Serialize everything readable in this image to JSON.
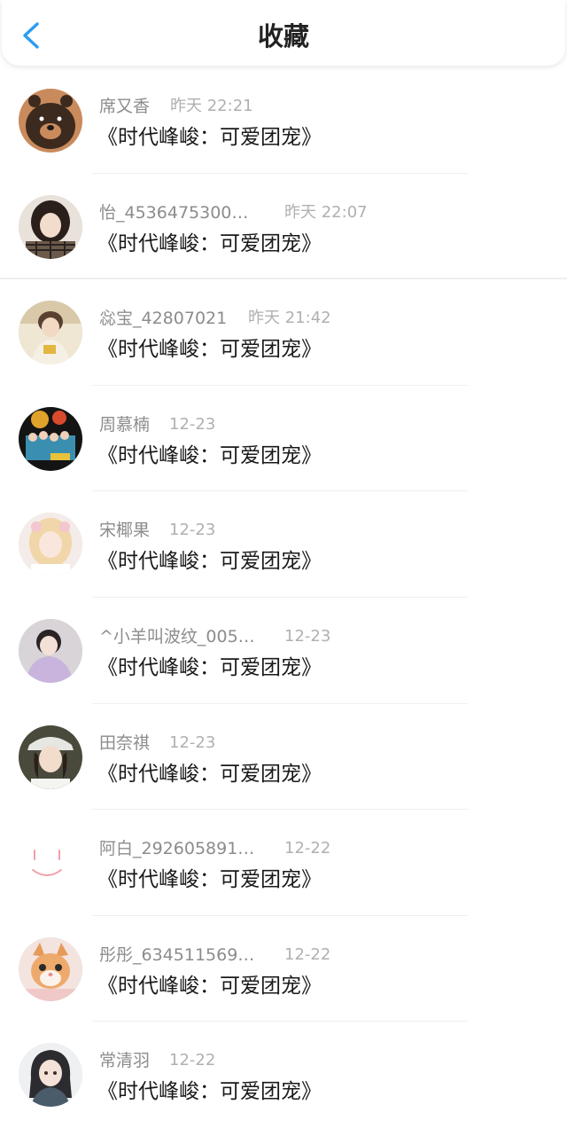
{
  "header": {
    "title": "收藏",
    "back_icon": "chevron-left-icon",
    "accent": "#2b9cf2"
  },
  "items": [
    {
      "name": "席又香",
      "time": "昨天 22:21",
      "post": "《时代峰峻：可爱团宠》",
      "avatar": "bear-avatar"
    },
    {
      "name": "怡_4536475300…",
      "time": "昨天 22:07",
      "post": "《时代峰峻：可爱团宠》",
      "avatar": "girl-photo-avatar"
    },
    {
      "name": "惢宝_42807021",
      "time": "昨天 21:42",
      "post": "《时代峰峻：可爱团宠》",
      "avatar": "boy-photo-avatar"
    },
    {
      "name": "周慕楠",
      "time": "12-23",
      "post": "《时代峰峻：可爱团宠》",
      "avatar": "group-photo-avatar"
    },
    {
      "name": "宋椰果",
      "time": "12-23",
      "post": "《时代峰峻：可爱团宠》",
      "avatar": "blonde-girl-avatar"
    },
    {
      "name": "^小羊叫波纹_005…",
      "time": "12-23",
      "post": "《时代峰峻：可爱团宠》",
      "avatar": "purple-girl-avatar"
    },
    {
      "name": "田奈祺",
      "time": "12-23",
      "post": "《时代峰峻：可爱团宠》",
      "avatar": "cap-girl-avatar"
    },
    {
      "name": "阿白_292605891…",
      "time": "12-22",
      "post": "《时代峰峻：可爱团宠》",
      "avatar": "smile-doodle-avatar"
    },
    {
      "name": "彤彤_634511569…",
      "time": "12-22",
      "post": "《时代峰峻：可爱团宠》",
      "avatar": "kitten-avatar"
    },
    {
      "name": "常清羽",
      "time": "12-22",
      "post": "《时代峰峻：可爱团宠》",
      "avatar": "anime-girl-avatar"
    }
  ]
}
